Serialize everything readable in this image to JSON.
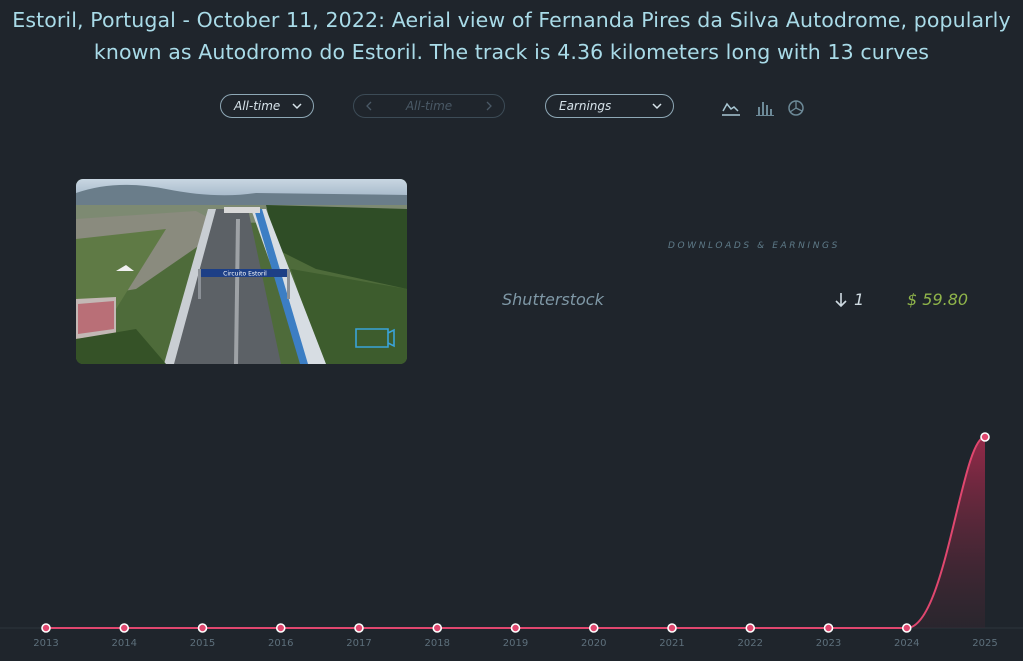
{
  "title": "Estoril, Portugal - October 11, 2022: Aerial view of Fernanda Pires da Silva Autodrome, popularly known as Autodromo do Estoril. The track is 4.36 kilometers long with 13 curves",
  "controls": {
    "period": "All-time",
    "range": "All-time",
    "metric": "Earnings",
    "view_icons": [
      "line-chart-icon",
      "bar-chart-icon",
      "pie-chart-icon"
    ]
  },
  "image": {
    "sign_text": "Circuito Estoril",
    "media_icon": "video-camera-icon"
  },
  "downloads": {
    "header": "DOWNLOADS & EARNINGS",
    "rows": [
      {
        "agency": "Shutterstock",
        "downloads": "1",
        "earnings": "$ 59.80"
      }
    ]
  },
  "colors": {
    "background": "#1f252c",
    "title": "#a9dbe8",
    "line": "#e0476f",
    "earnings": "#8fb44a"
  },
  "chart_data": {
    "type": "area",
    "x": [
      "2013",
      "2014",
      "2015",
      "2016",
      "2017",
      "2018",
      "2019",
      "2020",
      "2021",
      "2022",
      "2023",
      "2024",
      "2025"
    ],
    "values": [
      0,
      0,
      0,
      0,
      0,
      0,
      0,
      0,
      0,
      0,
      0,
      0,
      59.8
    ],
    "ylim": [
      0,
      59.8
    ],
    "grid": false,
    "legend": "none"
  }
}
